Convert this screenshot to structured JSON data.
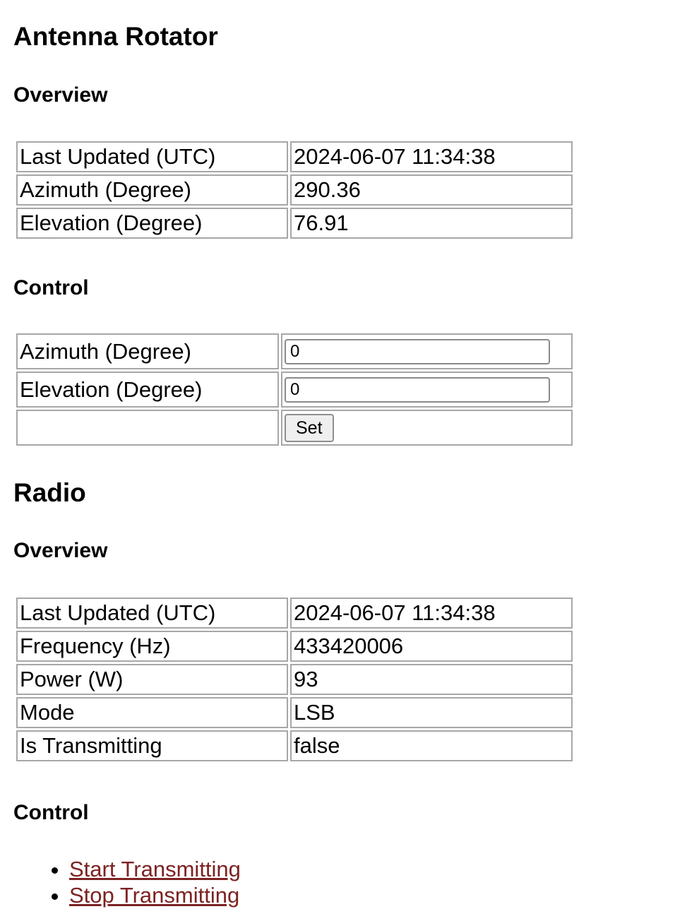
{
  "rotator": {
    "title": "Antenna Rotator",
    "overview_title": "Overview",
    "overview_rows": [
      {
        "label": "Last Updated (UTC)",
        "value": "2024-06-07 11:34:38"
      },
      {
        "label": "Azimuth (Degree)",
        "value": "290.36"
      },
      {
        "label": "Elevation (Degree)",
        "value": "76.91"
      }
    ],
    "control_title": "Control",
    "control": {
      "azimuth_label": "Azimuth (Degree)",
      "azimuth_value": "0",
      "elevation_label": "Elevation (Degree)",
      "elevation_value": "0",
      "set_label": "Set"
    }
  },
  "radio": {
    "title": "Radio",
    "overview_title": "Overview",
    "overview_rows": [
      {
        "label": "Last Updated (UTC)",
        "value": "2024-06-07 11:34:38"
      },
      {
        "label": "Frequency (Hz)",
        "value": "433420006"
      },
      {
        "label": "Power (W)",
        "value": "93"
      },
      {
        "label": "Mode",
        "value": "LSB"
      },
      {
        "label": "Is Transmitting",
        "value": "false"
      }
    ],
    "control_title": "Control",
    "links": [
      {
        "label": "Start Transmitting"
      },
      {
        "label": "Stop Transmitting"
      }
    ]
  },
  "colors": {
    "link": "#7d2222",
    "cell_border": "#a7a7a7"
  }
}
